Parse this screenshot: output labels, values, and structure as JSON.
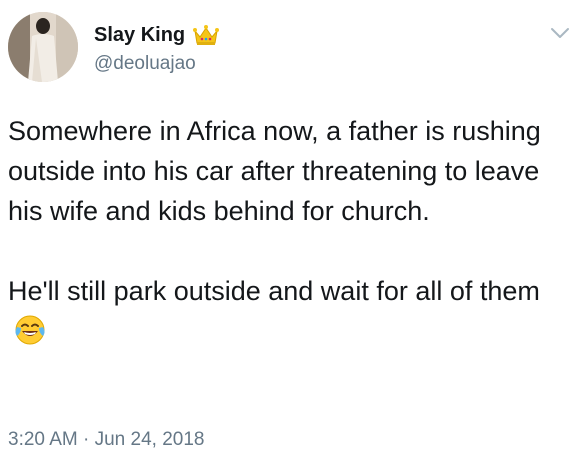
{
  "author": {
    "display_name": "Slay King",
    "handle": "@deoluajao",
    "name_badge": "crown-emoji-icon"
  },
  "tweet": {
    "paragraphs": [
      "Somewhere in Africa now, a father is rushing outside into his car after threatening to leave his wife and kids behind for church.",
      "He'll still park outside and wait for all of them"
    ],
    "trailing_emoji": "face-with-tears-of-joy-icon",
    "timestamp": "3:20 AM · Jun 24, 2018"
  },
  "menu": {
    "icon": "chevron-down-icon"
  },
  "colors": {
    "text_primary": "#14171a",
    "text_secondary": "#657786",
    "crown_gold": "#f5c518",
    "chevron": "#aab8c2"
  }
}
